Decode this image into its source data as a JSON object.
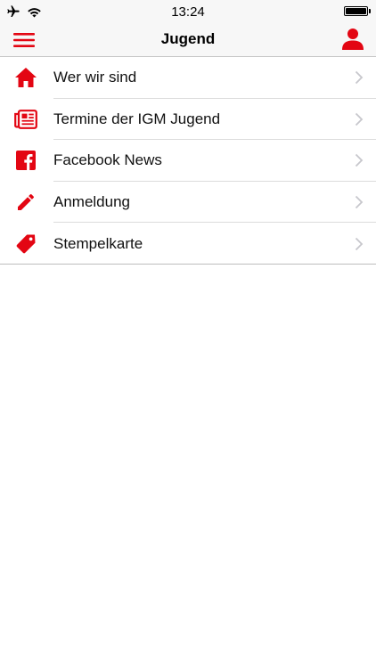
{
  "status_bar": {
    "time": "13:24",
    "icons": [
      "airplane-icon",
      "wifi-icon",
      "battery-icon"
    ],
    "battery_level": 1.0
  },
  "nav_bar": {
    "title": "Jugend",
    "left_icon": "hamburger-menu-icon",
    "right_icon": "person-icon"
  },
  "menu": {
    "items": [
      {
        "label": "Wer wir sind",
        "icon": "home-icon"
      },
      {
        "label": "Termine der IGM Jugend",
        "icon": "newspaper-icon"
      },
      {
        "label": "Facebook News",
        "icon": "facebook-icon"
      },
      {
        "label": "Anmeldung",
        "icon": "pencil-icon"
      },
      {
        "label": "Stempelkarte",
        "icon": "tag-icon"
      }
    ]
  },
  "colors": {
    "accent": "#e30613",
    "bar_background": "#f7f7f7",
    "chevron": "#c7c7cc"
  }
}
